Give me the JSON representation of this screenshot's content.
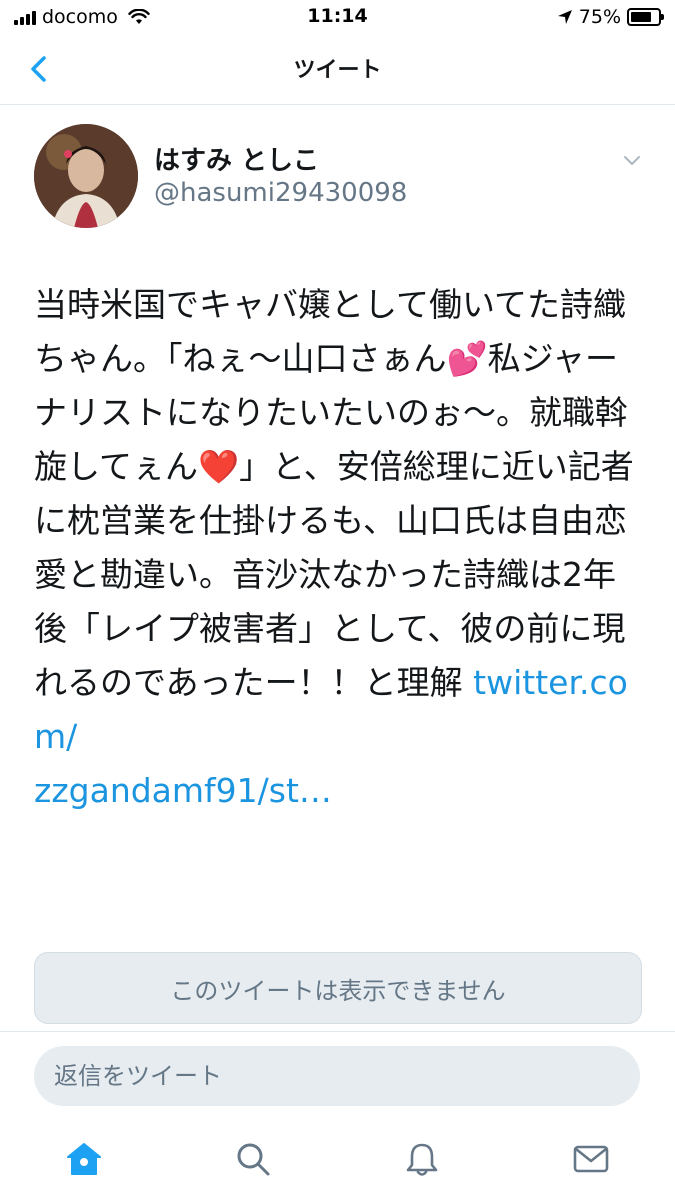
{
  "status_bar": {
    "carrier": "docomo",
    "time": "11:14",
    "battery_percent": "75%",
    "battery_level": 0.75,
    "icons": [
      "signal-icon",
      "wifi-icon",
      "location-arrow-icon",
      "battery-icon"
    ]
  },
  "nav": {
    "title": "ツイート",
    "back_icon": "chevron-left-icon"
  },
  "tweet": {
    "author": {
      "display_name": "はすみ としこ",
      "handle": "@hasumi29430098"
    },
    "text_before_link": "当時米国でキャバ嬢として働いてた詩織ちゃん。「ねぇ〜山口さぁん💕私ジャーナリストになりたいたいのぉ〜。就職斡旋してぇん❤️」と、安倍総理に近い記者に枕営業を仕掛けるも、山口氏は自由恋愛と勘違い。音沙汰なかった詩織は2年後「レイプ被害者」として、彼の前に現れるのであったー！！と理解 ",
    "link_text": "twitter.com/\nzzgandamf91/st…",
    "unavailable_notice": "このツイートは表示できません"
  },
  "reply": {
    "placeholder": "返信をツイート"
  },
  "tab_bar": {
    "tabs": [
      "home-icon",
      "search-icon",
      "notifications-icon",
      "messages-icon"
    ],
    "active": "home-icon"
  },
  "colors": {
    "accent": "#1da1f2",
    "link": "#1b95e0",
    "secondary_text": "#657786",
    "divider": "#e1e8ed"
  }
}
